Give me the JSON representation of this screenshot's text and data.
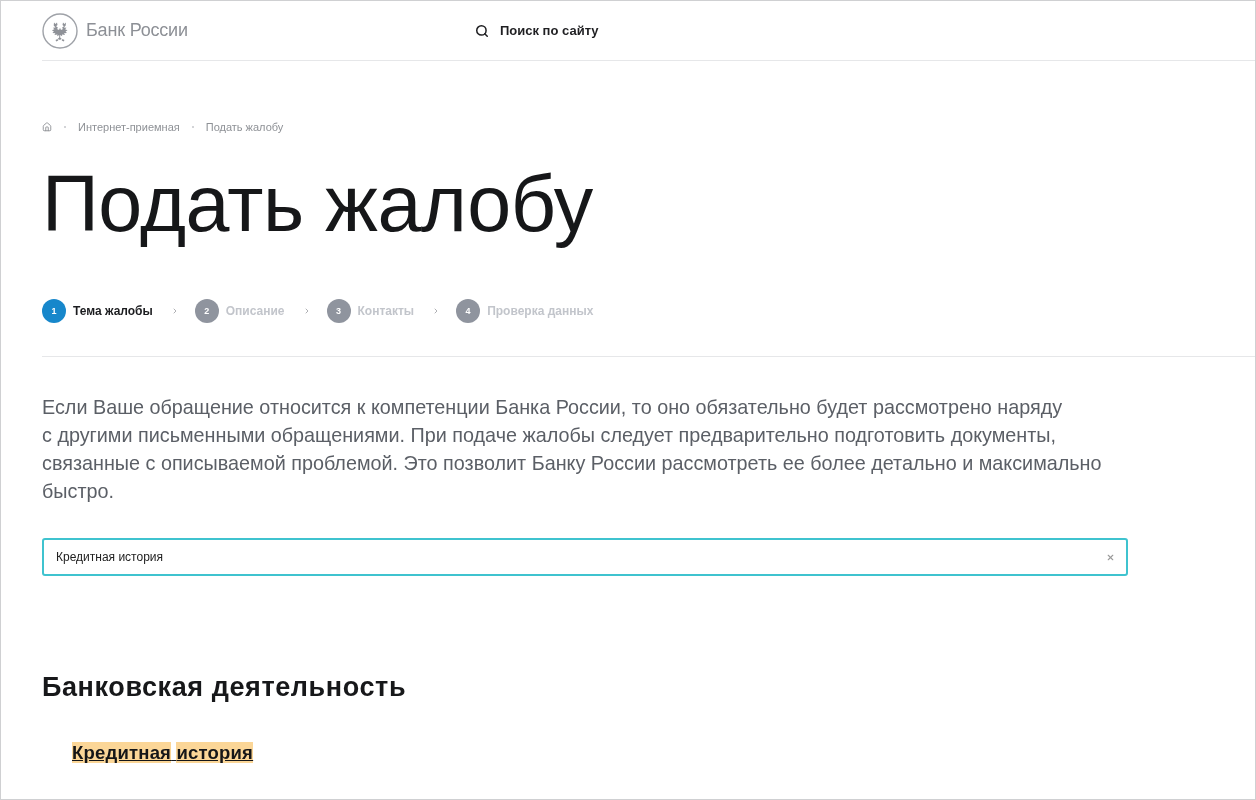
{
  "header": {
    "logo_text": "Банк России",
    "search_label": "Поиск по сайту"
  },
  "breadcrumbs": [
    "Интернет-приемная",
    "Подать жалобу"
  ],
  "title": "Подать жалобу",
  "steps": [
    {
      "number": "1",
      "label": "Тема жалобы",
      "selected": true
    },
    {
      "number": "2",
      "label": "Описание",
      "selected": false
    },
    {
      "number": "3",
      "label": "Контакты",
      "selected": false
    },
    {
      "number": "4",
      "label": "Проверка данных",
      "selected": false
    }
  ],
  "intro": "Если Ваше обращение относится к компетенции Банка России, то оно обязательно будет рассмотрено наряду с другими письменными обращениями. При подаче жалобы следует предварительно подготовить документы, связанные с описываемой проблемой. Это позволит Банку России рассмотреть ее более детально и максимально быстро.",
  "search": {
    "value": "Кредитная история",
    "focused": true
  },
  "results": [
    {
      "heading": "Банковская деятельность",
      "links": [
        {
          "text": "Кредитная история",
          "highlighted": true
        }
      ]
    }
  ]
}
